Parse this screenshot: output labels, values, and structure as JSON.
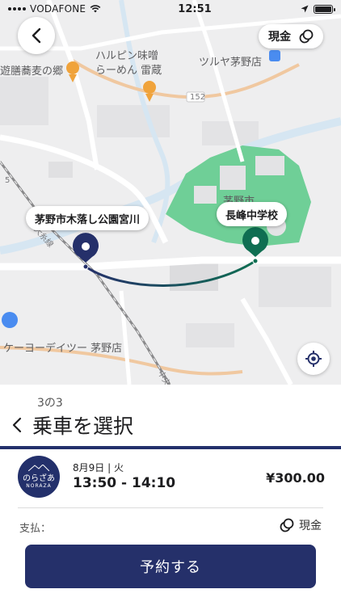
{
  "status_bar": {
    "carrier": "VODAFONE",
    "time": "12:51"
  },
  "map": {
    "labels": {
      "place1": "遊膳蕎麦の郷",
      "place2a": "ハルピン味噌",
      "place2b": "らーめん 雷蔵",
      "place3": "ツルヤ茅野店",
      "place4": "ケーヨーデイツー 茅野店",
      "city": "茅野市",
      "road_num": "152",
      "road_small": "5",
      "rail": "大糸線",
      "rail2": "中央"
    },
    "payment_pill_label": "現金",
    "pickup_label": "茅野市木落し公園宮川",
    "dropoff_label": "長峰中学校",
    "colors": {
      "pickup": "#25306a",
      "dropoff": "#0f6e52",
      "park": "#6fcf97"
    }
  },
  "sheet": {
    "step": "3の3",
    "title": "乗車を選択",
    "trip": {
      "logo_jp": "のらざあ",
      "logo_en": "NORAZA",
      "date": "8月9日 | 火",
      "time": "13:50 - 14:10",
      "price": "¥300.00"
    },
    "payment_label": "支払：",
    "payment_value": "現金",
    "reserve_button": "予約する"
  }
}
